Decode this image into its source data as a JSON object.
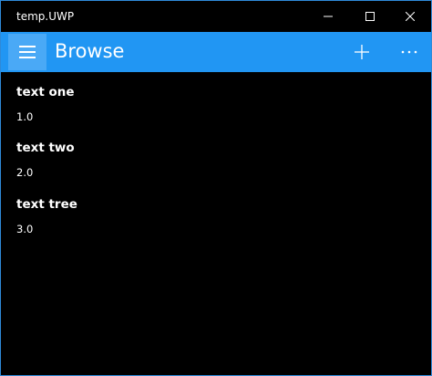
{
  "window": {
    "title": "temp.UWP",
    "icons": {
      "minimize": "minimize-icon",
      "maximize": "maximize-icon",
      "close": "close-icon"
    }
  },
  "appbar": {
    "title": "Browse",
    "icons": {
      "menu": "hamburger-menu-icon",
      "add": "plus-icon",
      "more": "more-ellipsis-icon"
    }
  },
  "items": [
    {
      "text": "text one",
      "value": "1.0"
    },
    {
      "text": "text two",
      "value": "2.0"
    },
    {
      "text": "text tree",
      "value": "3.0"
    }
  ],
  "colors": {
    "accent": "#2196f3",
    "hamburger_bg": "#4aa9f6",
    "background": "#000000",
    "text": "#ffffff"
  }
}
